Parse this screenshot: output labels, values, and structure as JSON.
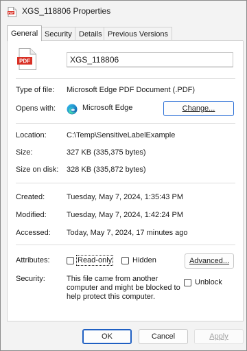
{
  "window": {
    "title": "XGS_118806 Properties",
    "title_icon_text": "PDF"
  },
  "tabs": [
    {
      "label": "General",
      "active": true
    },
    {
      "label": "Security",
      "active": false
    },
    {
      "label": "Details",
      "active": false
    },
    {
      "label": "Previous Versions",
      "active": false
    }
  ],
  "general": {
    "file_icon_text": "PDF",
    "file_name": "XGS_118806",
    "type_label": "Type of file:",
    "type_value": "Microsoft Edge PDF Document (.PDF)",
    "opens_label": "Opens with:",
    "opens_value": "Microsoft Edge",
    "change_button": "Change...",
    "location_label": "Location:",
    "location_value": "C:\\Temp\\SensitiveLabelExample",
    "size_label": "Size:",
    "size_value": "327 KB (335,375 bytes)",
    "size_on_disk_label": "Size on disk:",
    "size_on_disk_value": "328 KB (335,872 bytes)",
    "created_label": "Created:",
    "created_value": "Tuesday, May 7, 2024, 1:35:43 PM",
    "modified_label": "Modified:",
    "modified_value": "Tuesday, May 7, 2024, 1:42:24 PM",
    "accessed_label": "Accessed:",
    "accessed_value": "Today, May 7, 2024, 17 minutes ago",
    "attributes_label": "Attributes:",
    "readonly_label": "Read-only",
    "readonly_checked": false,
    "hidden_label": "Hidden",
    "hidden_checked": false,
    "advanced_button": "Advanced...",
    "security_label": "Security:",
    "security_text": "This file came from another computer and might be blocked to help protect this computer.",
    "unblock_label": "Unblock",
    "unblock_checked": false
  },
  "footer": {
    "ok_button": "OK",
    "cancel_button": "Cancel",
    "apply_button": "Apply"
  },
  "colors": {
    "pdf_red": "#d93025",
    "focus_blue": "#1f5fc2"
  }
}
